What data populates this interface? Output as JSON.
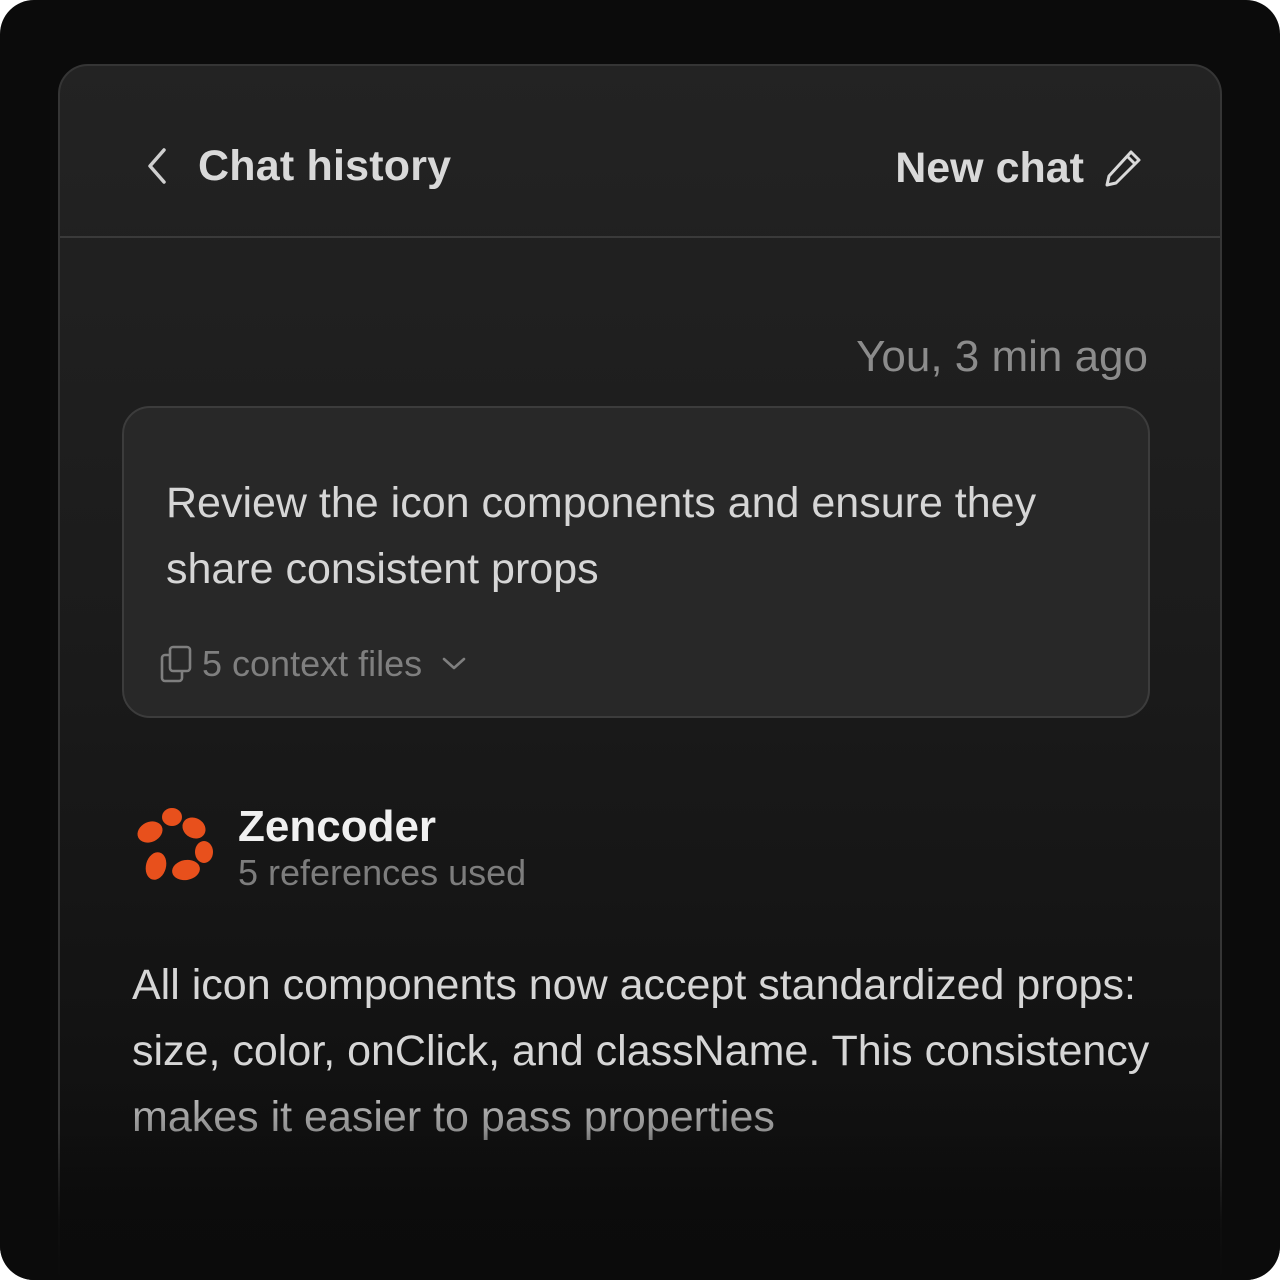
{
  "header": {
    "title": "Chat history",
    "new_chat_label": "New chat"
  },
  "message": {
    "meta": "You, 3 min ago",
    "text": "Review the icon components and ensure they share consistent props",
    "context_label": "5 context files"
  },
  "agent": {
    "name": "Zencoder",
    "refs": "5 references used",
    "brand_color": "#e8501c"
  },
  "answer": {
    "text": "All icon components now accept standardized props: size, color, onClick, and className. This consistency makes it easier to pass properties"
  }
}
